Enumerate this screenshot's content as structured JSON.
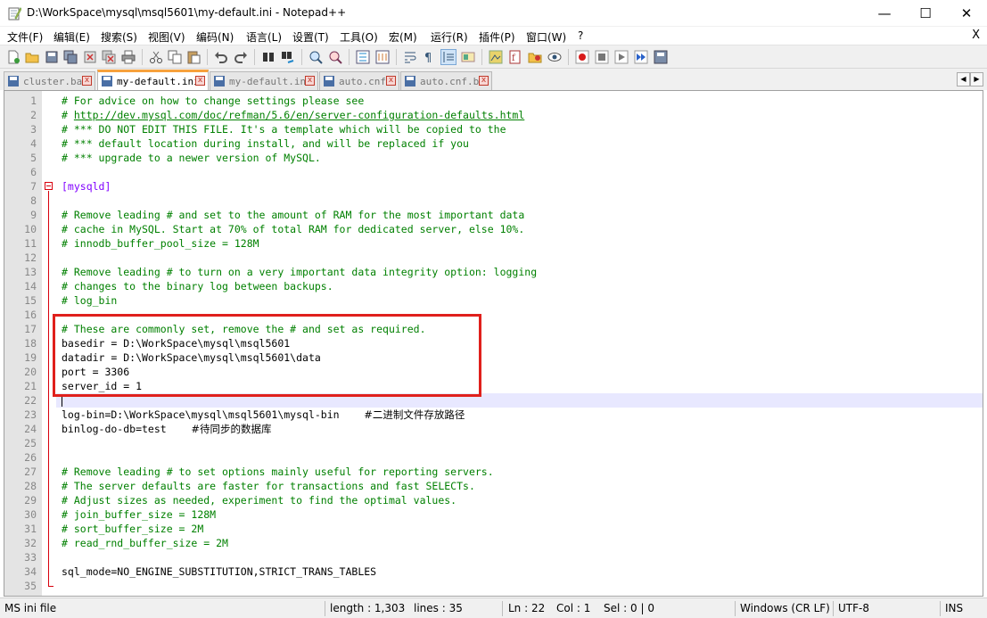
{
  "window": {
    "title": "D:\\WorkSpace\\mysql\\msql5601\\my-default.ini - Notepad++",
    "controls": {
      "minimize": "—",
      "maximize": "☐",
      "close": "✕"
    }
  },
  "menu": {
    "items": [
      "文件(F)",
      "编辑(E)",
      "搜索(S)",
      "视图(V)",
      "编码(N)",
      "语言(L)",
      "设置(T)",
      "工具(O)",
      "宏(M)",
      "运行(R)",
      "插件(P)",
      "窗口(W)",
      "?"
    ],
    "close_doc": "X"
  },
  "toolbar": {
    "icons": [
      "new-file-icon",
      "open-file-icon",
      "save-icon",
      "save-all-icon",
      "close-icon",
      "close-all-icon",
      "print-icon",
      "cut-icon",
      "copy-icon",
      "paste-icon",
      "undo-icon",
      "redo-icon",
      "find-icon",
      "replace-icon",
      "zoom-in-icon",
      "zoom-out-icon",
      "sync-vertical-icon",
      "sync-horizontal-icon",
      "word-wrap-icon",
      "show-all-chars-icon",
      "indent-guide-icon",
      "user-language-icon",
      "doc-map-icon",
      "function-list-icon",
      "folder-workspace-icon",
      "monitoring-icon",
      "record-macro-icon",
      "stop-macro-icon",
      "play-macro-icon",
      "run-macro-multiple-icon",
      "save-macro-icon"
    ]
  },
  "tabs": [
    {
      "label": "cluster.bat",
      "active": false
    },
    {
      "label": "my-default.ini",
      "active": true
    },
    {
      "label": "my-default.ini",
      "active": false
    },
    {
      "label": "auto.cnf",
      "active": false
    },
    {
      "label": "auto.cnf.bk",
      "active": false
    }
  ],
  "editor": {
    "current_line": 22,
    "lines": [
      {
        "n": "1",
        "text": "# For advice on how to change settings please see",
        "kind": "comment"
      },
      {
        "n": "2",
        "text": "# ",
        "link": "http://dev.mysql.com/doc/refman/5.6/en/server-configuration-defaults.html",
        "kind": "comment"
      },
      {
        "n": "3",
        "text": "# *** DO NOT EDIT THIS FILE. It's a template which will be copied to the",
        "kind": "comment"
      },
      {
        "n": "4",
        "text": "# *** default location during install, and will be replaced if you",
        "kind": "comment"
      },
      {
        "n": "5",
        "text": "# *** upgrade to a newer version of MySQL.",
        "kind": "comment"
      },
      {
        "n": "6",
        "text": "",
        "kind": "plain"
      },
      {
        "n": "7",
        "text": "[mysqld]",
        "kind": "section"
      },
      {
        "n": "8",
        "text": "",
        "kind": "plain"
      },
      {
        "n": "9",
        "text": "# Remove leading # and set to the amount of RAM for the most important data",
        "kind": "comment"
      },
      {
        "n": "10",
        "text": "# cache in MySQL. Start at 70% of total RAM for dedicated server, else 10%.",
        "kind": "comment"
      },
      {
        "n": "11",
        "text": "# innodb_buffer_pool_size = 128M",
        "kind": "comment"
      },
      {
        "n": "12",
        "text": "",
        "kind": "plain"
      },
      {
        "n": "13",
        "text": "# Remove leading # to turn on a very important data integrity option: logging",
        "kind": "comment"
      },
      {
        "n": "14",
        "text": "# changes to the binary log between backups.",
        "kind": "comment"
      },
      {
        "n": "15",
        "text": "# log_bin",
        "kind": "comment"
      },
      {
        "n": "16",
        "text": "",
        "kind": "plain"
      },
      {
        "n": "17",
        "text": "# These are commonly set, remove the # and set as required.",
        "kind": "comment"
      },
      {
        "n": "18",
        "text": "basedir = D:\\WorkSpace\\mysql\\msql5601",
        "kind": "plain"
      },
      {
        "n": "19",
        "text": "datadir = D:\\WorkSpace\\mysql\\msql5601\\data",
        "kind": "plain"
      },
      {
        "n": "20",
        "text": "port = 3306",
        "kind": "plain"
      },
      {
        "n": "21",
        "text": "server_id = 1",
        "kind": "plain"
      },
      {
        "n": "22",
        "text": "",
        "kind": "plain"
      },
      {
        "n": "23",
        "text": "log-bin=D:\\WorkSpace\\mysql\\msql5601\\mysql-bin    ",
        "cjk": "#二进制文件存放路径",
        "kind": "plain"
      },
      {
        "n": "24",
        "text": "binlog-do-db=test    ",
        "cjk": "#待同步的数据库",
        "kind": "plain"
      },
      {
        "n": "25",
        "text": "",
        "kind": "plain"
      },
      {
        "n": "26",
        "text": "",
        "kind": "plain"
      },
      {
        "n": "27",
        "text": "# Remove leading # to set options mainly useful for reporting servers.",
        "kind": "comment"
      },
      {
        "n": "28",
        "text": "# The server defaults are faster for transactions and fast SELECTs.",
        "kind": "comment"
      },
      {
        "n": "29",
        "text": "# Adjust sizes as needed, experiment to find the optimal values.",
        "kind": "comment"
      },
      {
        "n": "30",
        "text": "# join_buffer_size = 128M",
        "kind": "comment"
      },
      {
        "n": "31",
        "text": "# sort_buffer_size = 2M",
        "kind": "comment"
      },
      {
        "n": "32",
        "text": "# read_rnd_buffer_size = 2M",
        "kind": "comment"
      },
      {
        "n": "33",
        "text": "",
        "kind": "plain"
      },
      {
        "n": "34",
        "text": "sql_mode=NO_ENGINE_SUBSTITUTION,STRICT_TRANS_TABLES",
        "kind": "plain"
      },
      {
        "n": "35",
        "text": "",
        "kind": "plain"
      }
    ]
  },
  "status": {
    "file_type": "MS ini file",
    "length": "length : 1,303",
    "lines": "lines : 35",
    "ln": "Ln : 22",
    "col": "Col : 1",
    "sel": "Sel : 0 | 0",
    "eol": "Windows (CR LF)",
    "encoding": "UTF-8",
    "mode": "INS"
  },
  "colors": {
    "comment": "#008000",
    "section": "#8000ff",
    "highlight_box": "#e0201c",
    "active_tab_accent": "#f7a13c",
    "fold_marker": "#d8000c"
  }
}
